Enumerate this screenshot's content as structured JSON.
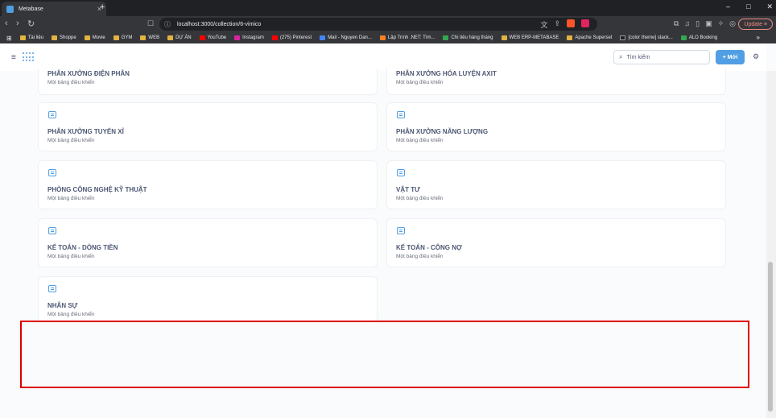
{
  "browser": {
    "tab_title": "Metabase",
    "url": "localhost:3000/collection/6-vimico",
    "update_label": "Update",
    "brave_badge": "8"
  },
  "bookmarks": [
    {
      "label": "Tài liệu",
      "icon": "folder-icon"
    },
    {
      "label": "Shoppe",
      "icon": "folder-icon"
    },
    {
      "label": "Movie",
      "icon": "folder-icon"
    },
    {
      "label": "GYM",
      "icon": "folder-icon"
    },
    {
      "label": "WEB",
      "icon": "folder-icon"
    },
    {
      "label": "DỰ ÁN",
      "icon": "folder-icon"
    },
    {
      "label": "YouTube",
      "icon": "youtube-icon"
    },
    {
      "label": "Instagram",
      "icon": "instagram-icon"
    },
    {
      "label": "(275) Pinterest",
      "icon": "pinterest-icon"
    },
    {
      "label": "Mail - Nguyen Dan...",
      "icon": "outlook-icon"
    },
    {
      "label": "Lập Trình .NET: Tìm...",
      "icon": "blogger-icon"
    },
    {
      "label": "Chi tiêu hàng tháng",
      "icon": "sheets-icon"
    },
    {
      "label": "WEB ERP-METABASE",
      "icon": "folder-icon"
    },
    {
      "label": "Apache Superset",
      "icon": "folder-icon"
    },
    {
      "label": "[color theme] stack...",
      "icon": "stackoverflow-icon"
    },
    {
      "label": "ALO Booking",
      "icon": "alo-icon"
    }
  ],
  "header": {
    "search_placeholder": "Tìm kiếm",
    "new_button": "Mới"
  },
  "cards": [
    {
      "title": "PHÂN XƯỞNG ĐIỆN PHÂN",
      "subtitle": "Một bảng điều khiển"
    },
    {
      "title": "PHÂN XƯỞNG HÓA LUYỆN AXIT",
      "subtitle": "Một bảng điều khiển"
    },
    {
      "title": "PHÂN XƯỞNG TUYỂN XỈ",
      "subtitle": "Một bảng điều khiển"
    },
    {
      "title": "PHÂN XƯỞNG NĂNG LƯỢNG",
      "subtitle": "Một bảng điều khiển"
    },
    {
      "title": "PHÒNG CÔNG NGHỆ KỸ THUẬT",
      "subtitle": "Một bảng điều khiển"
    },
    {
      "title": "VẬT TƯ",
      "subtitle": "Một bảng điều khiển"
    },
    {
      "title": "KẾ TOÁN - DÒNG TIỀN",
      "subtitle": "Một bảng điều khiển"
    },
    {
      "title": "KẾ TOÁN - CÔNG NỢ",
      "subtitle": "Một bảng điều khiển"
    },
    {
      "title": "NHÂN SỰ",
      "subtitle": "Một bảng điều khiển"
    }
  ],
  "colors": {
    "accent": "#509ee3",
    "highlight_box": "#e00000"
  }
}
